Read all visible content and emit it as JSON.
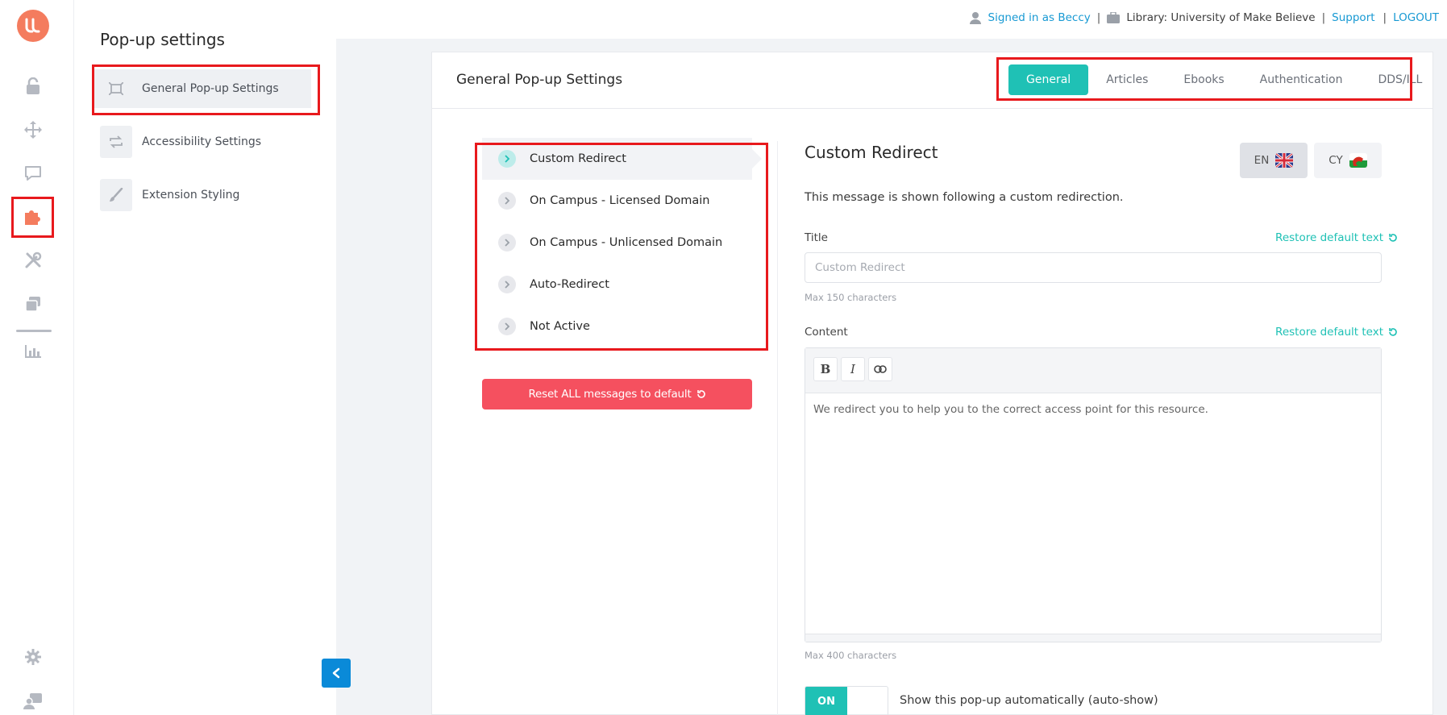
{
  "app": {
    "logo_icon": "ll-logo-icon",
    "accent": "#1fc1b5",
    "danger": "#f5505f",
    "link": "#1799d3"
  },
  "rail": {
    "items": [
      {
        "icon": "unlock-icon"
      },
      {
        "icon": "move-arrows-icon"
      },
      {
        "icon": "chat-bubble-icon"
      },
      {
        "icon": "puzzle-piece-icon",
        "active": true
      },
      {
        "icon": "tools-icon"
      },
      {
        "icon": "stacked-cards-icon"
      },
      {
        "icon": "bar-chart-icon"
      },
      {
        "icon": "gear-icon"
      },
      {
        "icon": "user-card-icon"
      }
    ]
  },
  "subnav": {
    "title": "Pop-up settings",
    "items": [
      {
        "label": "General Pop-up Settings",
        "icon": "frame-icon",
        "active": true
      },
      {
        "label": "Accessibility Settings",
        "icon": "repeat-icon"
      },
      {
        "label": "Extension Styling",
        "icon": "brush-icon"
      }
    ]
  },
  "topbar": {
    "signed_in": "Signed in as Beccy",
    "library": "Library: University of Make Believe",
    "support": "Support",
    "logout": "LOGOUT",
    "separator": "|"
  },
  "card": {
    "title": "General Pop-up Settings",
    "tabs": [
      "General",
      "Articles",
      "Ebooks",
      "Authentication",
      "DDS/ILL"
    ],
    "active_tab": "General"
  },
  "messages": {
    "items": [
      "Custom Redirect",
      "On Campus - Licensed Domain",
      "On Campus - Unlicensed Domain",
      "Auto-Redirect",
      "Not Active"
    ],
    "active": "Custom Redirect",
    "reset_label": "Reset ALL messages to default"
  },
  "editor": {
    "heading": "Custom Redirect",
    "lang_en": "EN",
    "lang_cy": "CY",
    "description": "This message is shown following a custom redirection.",
    "title_label": "Title",
    "title_placeholder": "Custom Redirect",
    "title_hint": "Max 150 characters",
    "restore_label": "Restore default text",
    "content_label": "Content",
    "content_text": "We redirect you to help you to the correct access point for this resource.",
    "content_hint": "Max 400 characters",
    "toolbar": {
      "bold": "B",
      "italic": "I"
    },
    "toggle_on": "ON",
    "toggle_label": "Show this pop-up automatically (auto-show)"
  }
}
